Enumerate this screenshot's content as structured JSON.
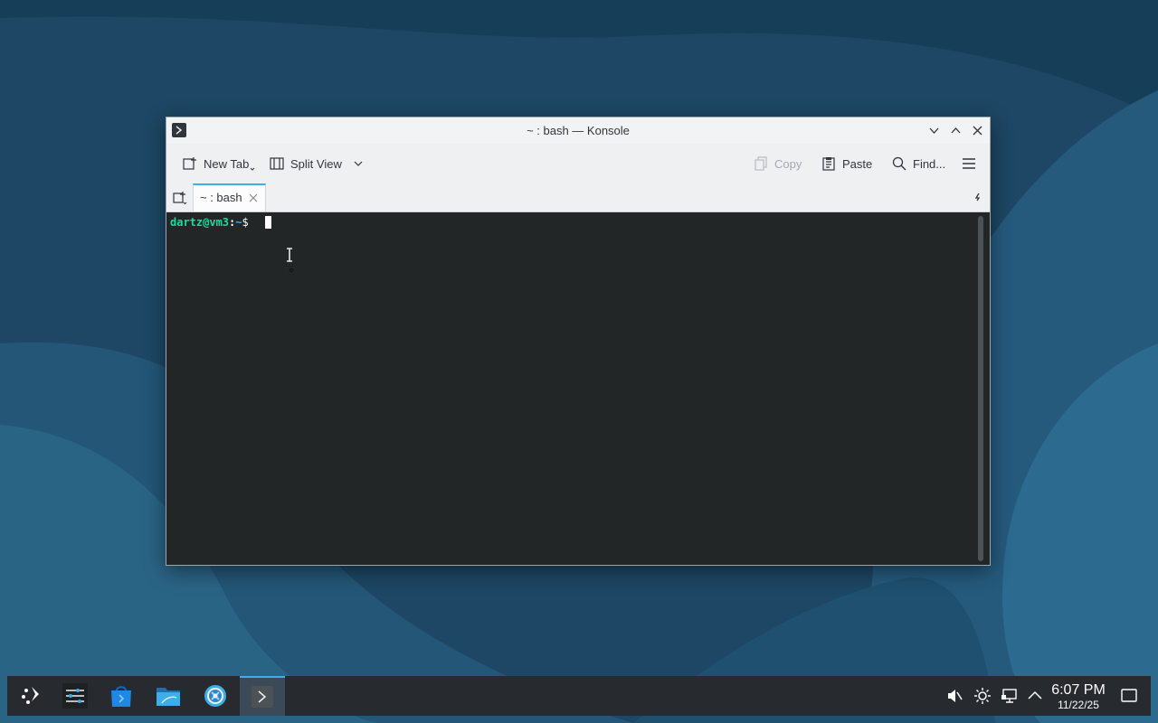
{
  "window": {
    "title": "~ : bash — Konsole",
    "app_icon": "konsole-icon"
  },
  "toolbar": {
    "new_tab": "New Tab",
    "split_view": "Split View",
    "copy": "Copy",
    "paste": "Paste",
    "find": "Find..."
  },
  "tabs": [
    {
      "label": "~ : bash",
      "active": true
    }
  ],
  "terminal": {
    "user_host": "dartz@vm3",
    "separator": ":",
    "cwd": "~",
    "prompt_symbol": "$"
  },
  "taskbar": {
    "items": [
      "application-launcher-icon",
      "system-settings-icon",
      "discover-icon",
      "dolphin-icon",
      "settings-gear-icon",
      "konsole-icon"
    ],
    "tray": [
      "volume-muted-icon",
      "brightness-icon",
      "network-icon",
      "chevron-up-icon"
    ],
    "clock": {
      "time": "6:07 PM",
      "date": "11/22/25"
    },
    "show_desktop": "show-desktop-icon"
  },
  "colors": {
    "accent": "#3daee9",
    "terminal_bg": "#232627",
    "prompt_user": "#1cdc9a"
  }
}
